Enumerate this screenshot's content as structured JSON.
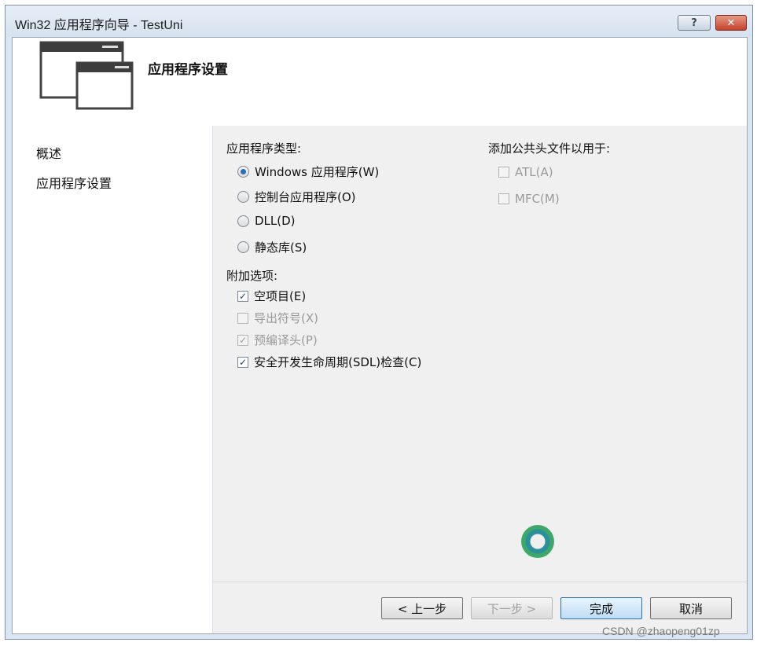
{
  "window": {
    "title": "Win32 应用程序向导 - TestUni",
    "help_label": "?",
    "close_label": "✕"
  },
  "header": {
    "title": "应用程序设置"
  },
  "sidebar": {
    "items": [
      {
        "label": "概述"
      },
      {
        "label": "应用程序设置"
      }
    ]
  },
  "app_type": {
    "label": "应用程序类型:",
    "options": [
      {
        "label": "Windows 应用程序(W)",
        "selected": true
      },
      {
        "label": "控制台应用程序(O)",
        "selected": false
      },
      {
        "label": "DLL(D)",
        "selected": false
      },
      {
        "label": "静态库(S)",
        "selected": false
      }
    ]
  },
  "extra_options": {
    "label": "附加选项:",
    "items": [
      {
        "label": "空项目(E)",
        "checked": true,
        "enabled": true
      },
      {
        "label": "导出符号(X)",
        "checked": false,
        "enabled": false
      },
      {
        "label": "预编译头(P)",
        "checked": true,
        "enabled": false
      },
      {
        "label": "安全开发生命周期(SDL)检查(C)",
        "checked": true,
        "enabled": true
      }
    ]
  },
  "common_headers": {
    "label": "添加公共头文件以用于:",
    "items": [
      {
        "label": "ATL(A)",
        "checked": false,
        "enabled": false
      },
      {
        "label": "MFC(M)",
        "checked": false,
        "enabled": false
      }
    ]
  },
  "buttons": {
    "prev": "< 上一步",
    "next": "下一步 >",
    "finish": "完成",
    "cancel": "取消"
  },
  "watermark": "CSDN @zhaopeng01zp",
  "icons": {
    "wizard": "wizard-windows-icon",
    "loading": "loading-spinner-icon"
  }
}
